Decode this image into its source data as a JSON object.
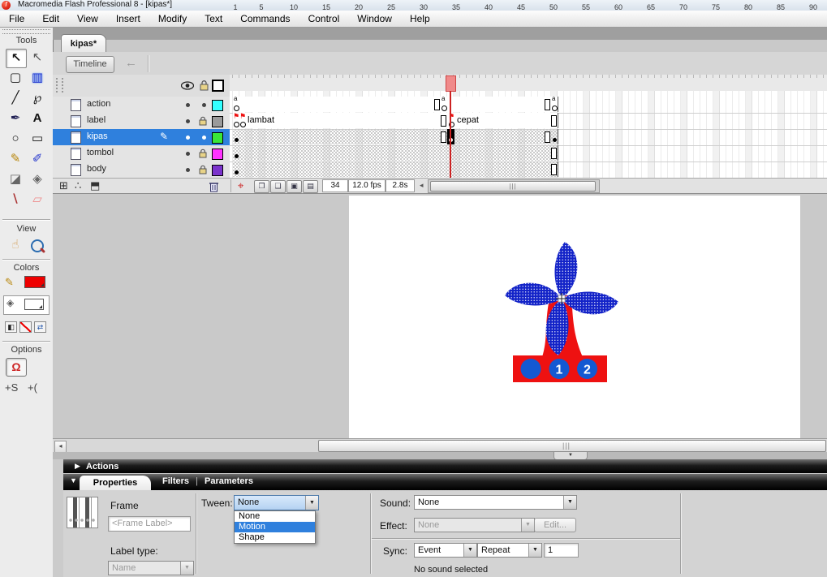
{
  "window": {
    "title": "Macromedia Flash Professional 8 - [kipas*]",
    "menu_items": [
      "File",
      "Edit",
      "View",
      "Insert",
      "Modify",
      "Text",
      "Commands",
      "Control",
      "Window",
      "Help"
    ]
  },
  "tools_panel": {
    "sections": {
      "tools": "Tools",
      "view": "View",
      "colors": "Colors",
      "options": "Options"
    },
    "tools": [
      {
        "name": "selection-tool",
        "glyph": "↖"
      },
      {
        "name": "subselection-tool",
        "glyph": "↖"
      },
      {
        "name": "free-transform-tool",
        "glyph": "▢"
      },
      {
        "name": "gradient-transform-tool",
        "glyph": "▥"
      },
      {
        "name": "line-tool",
        "glyph": "╱"
      },
      {
        "name": "lasso-tool",
        "glyph": "℘"
      },
      {
        "name": "pen-tool",
        "glyph": "✒"
      },
      {
        "name": "text-tool",
        "glyph": "A"
      },
      {
        "name": "oval-tool",
        "glyph": "○"
      },
      {
        "name": "rectangle-tool",
        "glyph": "▭"
      },
      {
        "name": "pencil-tool",
        "glyph": "✎"
      },
      {
        "name": "brush-tool",
        "glyph": "✐"
      },
      {
        "name": "ink-bottle-tool",
        "glyph": "◪"
      },
      {
        "name": "paint-bucket-tool",
        "glyph": "◈"
      },
      {
        "name": "eyedropper-tool",
        "glyph": "∖"
      },
      {
        "name": "eraser-tool",
        "glyph": "▱"
      }
    ],
    "view_tools": [
      {
        "name": "hand-tool",
        "glyph": "☝"
      },
      {
        "name": "zoom-tool",
        "glyph": ""
      }
    ],
    "colors": {
      "stroke_color": "#ee0000",
      "fill_color": "#ffffff"
    },
    "options": {
      "snap_glyph": "Ω",
      "smooth_glyph": "+S",
      "straighten_glyph": "+("
    }
  },
  "document": {
    "tab_label": "kipas*",
    "timeline_button": "Timeline",
    "back_arrow": "←"
  },
  "timeline": {
    "ruler_numbers": [
      "1",
      "5",
      "10",
      "15",
      "20",
      "25",
      "30",
      "35",
      "40",
      "45",
      "50",
      "55",
      "60",
      "65",
      "70",
      "75",
      "80",
      "85",
      "90"
    ],
    "layers": [
      {
        "name": "action",
        "outline_color": "#33ffff"
      },
      {
        "name": "label",
        "outline_color": "#9a9a9a"
      },
      {
        "name": "kipas",
        "outline_color": "#39e639"
      },
      {
        "name": "tombol",
        "outline_color": "#ff33ff"
      },
      {
        "name": "body",
        "outline_color": "#7b33cc"
      }
    ],
    "action_marker": "a",
    "frame_labels": {
      "slow": "lambat",
      "fast": "cepat"
    },
    "status": {
      "current_frame": "34",
      "frame_rate": "12.0 fps",
      "elapsed_time": "2.8s"
    }
  },
  "stage": {
    "base_buttons": [
      "",
      "1",
      "2"
    ]
  },
  "actions_panel": {
    "title": "Actions",
    "expander": "▶"
  },
  "properties_panel": {
    "tabs": {
      "properties": "Properties",
      "filters": "Filters",
      "parameters": "Parameters",
      "separator": "|",
      "collapse": "▼"
    },
    "element_type": "Frame",
    "frame_label_placeholder": "<Frame Label>",
    "label_type_label": "Label type:",
    "label_type_value": "Name",
    "tween_label": "Tween:",
    "tween_value": "None",
    "tween_options": [
      "None",
      "Motion",
      "Shape"
    ],
    "sound_label": "Sound:",
    "sound_value": "None",
    "effect_label": "Effect:",
    "effect_value": "None",
    "edit_button": "Edit...",
    "sync_label": "Sync:",
    "sync_value": "Event",
    "repeat_value": "Repeat",
    "repeat_count": "1",
    "status_text": "No sound selected"
  }
}
